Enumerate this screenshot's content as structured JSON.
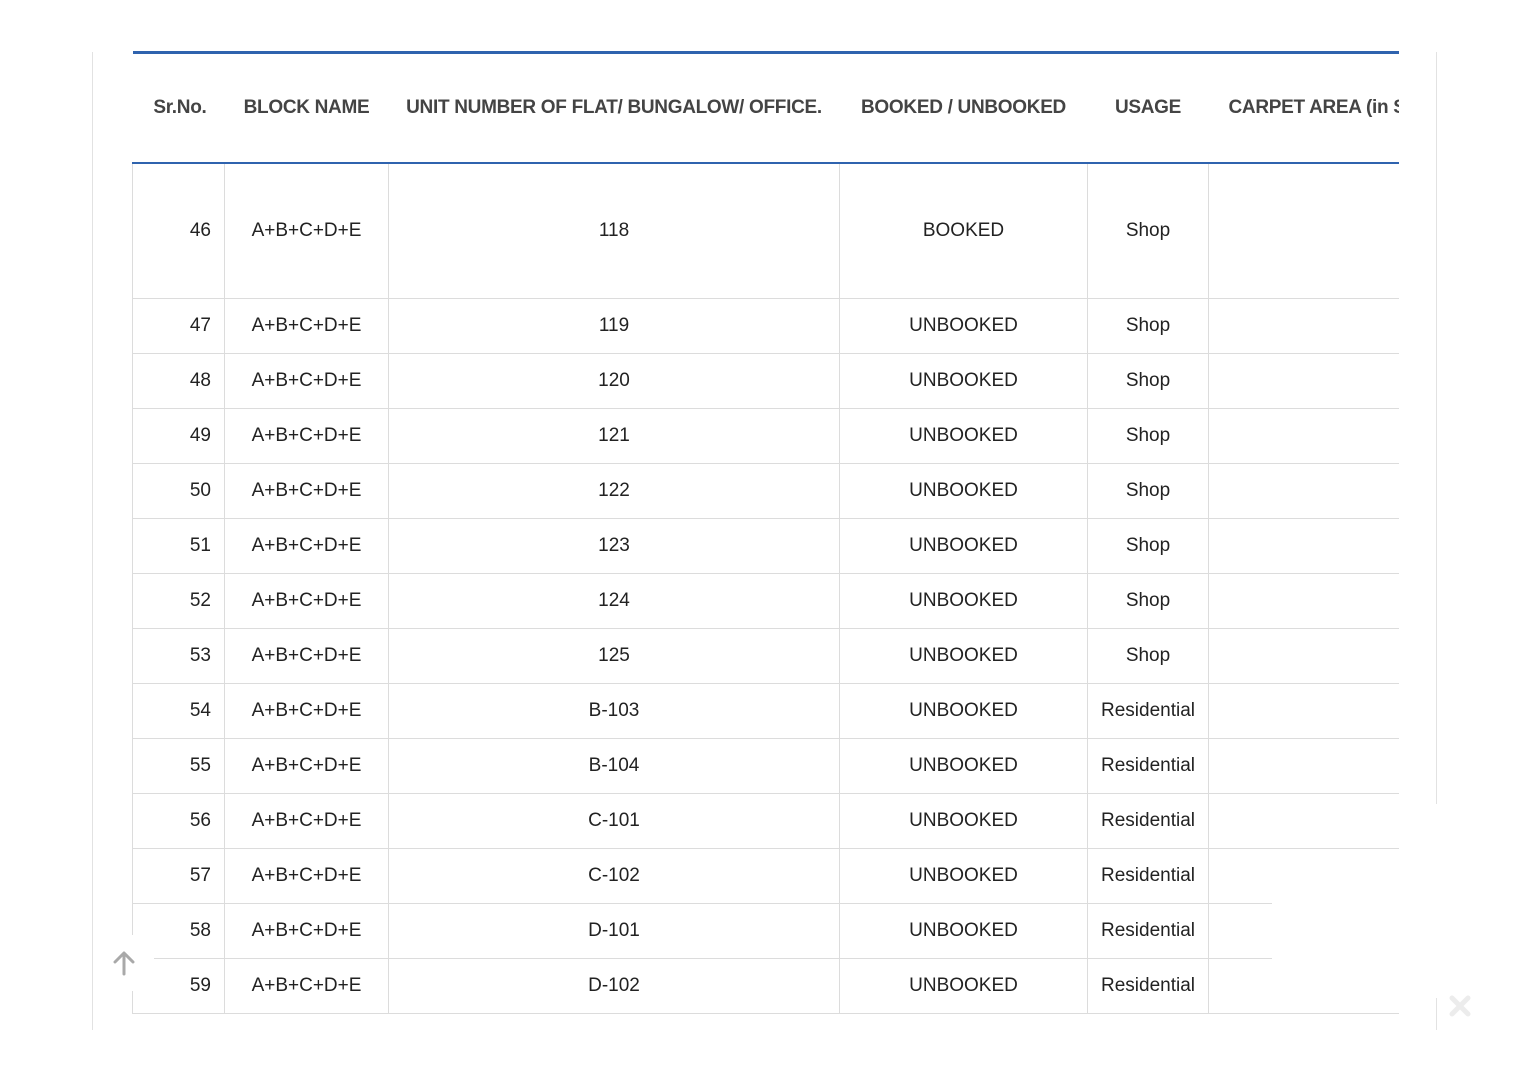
{
  "table": {
    "headers": {
      "srno": "Sr.No.",
      "block": "BLOCK NAME",
      "unit": "UNIT NUMBER OF FLAT/ BUNGALOW/ OFFICE.",
      "status": "BOOKED / UNBOOKED",
      "usage": "USAGE",
      "carpet": "CARPET AREA (in Sq"
    },
    "rows": [
      {
        "srno": "46",
        "block": "A+B+C+D+E",
        "unit": "118",
        "status": "BOOKED",
        "usage": "Shop",
        "carpet": ""
      },
      {
        "srno": "47",
        "block": "A+B+C+D+E",
        "unit": "119",
        "status": "UNBOOKED",
        "usage": "Shop",
        "carpet": ""
      },
      {
        "srno": "48",
        "block": "A+B+C+D+E",
        "unit": "120",
        "status": "UNBOOKED",
        "usage": "Shop",
        "carpet": ""
      },
      {
        "srno": "49",
        "block": "A+B+C+D+E",
        "unit": "121",
        "status": "UNBOOKED",
        "usage": "Shop",
        "carpet": ""
      },
      {
        "srno": "50",
        "block": "A+B+C+D+E",
        "unit": "122",
        "status": "UNBOOKED",
        "usage": "Shop",
        "carpet": ""
      },
      {
        "srno": "51",
        "block": "A+B+C+D+E",
        "unit": "123",
        "status": "UNBOOKED",
        "usage": "Shop",
        "carpet": ""
      },
      {
        "srno": "52",
        "block": "A+B+C+D+E",
        "unit": "124",
        "status": "UNBOOKED",
        "usage": "Shop",
        "carpet": ""
      },
      {
        "srno": "53",
        "block": "A+B+C+D+E",
        "unit": "125",
        "status": "UNBOOKED",
        "usage": "Shop",
        "carpet": ""
      },
      {
        "srno": "54",
        "block": "A+B+C+D+E",
        "unit": "B-103",
        "status": "UNBOOKED",
        "usage": "Residential",
        "carpet": ""
      },
      {
        "srno": "55",
        "block": "A+B+C+D+E",
        "unit": "B-104",
        "status": "UNBOOKED",
        "usage": "Residential",
        "carpet": ""
      },
      {
        "srno": "56",
        "block": "A+B+C+D+E",
        "unit": "C-101",
        "status": "UNBOOKED",
        "usage": "Residential",
        "carpet": ""
      },
      {
        "srno": "57",
        "block": "A+B+C+D+E",
        "unit": "C-102",
        "status": "UNBOOKED",
        "usage": "Residential",
        "carpet": ""
      },
      {
        "srno": "58",
        "block": "A+B+C+D+E",
        "unit": "D-101",
        "status": "UNBOOKED",
        "usage": "Residential",
        "carpet": ""
      },
      {
        "srno": "59",
        "block": "A+B+C+D+E",
        "unit": "D-102",
        "status": "UNBOOKED",
        "usage": "Residential",
        "carpet": ""
      }
    ]
  },
  "colors": {
    "header_rule": "#2f63ae",
    "cell_border": "#dcdcdc",
    "icon_gray": "#b5b5b5"
  },
  "icons": {
    "scroll_top": "arrow-up-icon",
    "close": "close-icon"
  }
}
